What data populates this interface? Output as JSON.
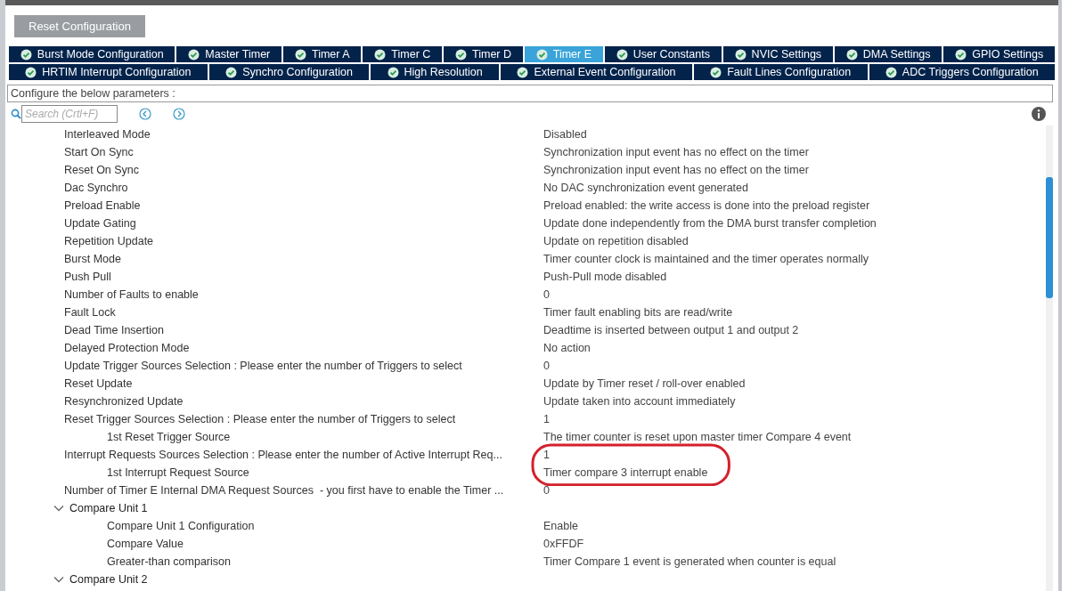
{
  "reset_button": "Reset Configuration",
  "tab_rows": [
    [
      {
        "label": "Burst Mode Configuration",
        "selected": false
      },
      {
        "label": "Master Timer",
        "selected": false
      },
      {
        "label": "Timer A",
        "selected": false
      },
      {
        "label": "Timer C",
        "selected": false
      },
      {
        "label": "Timer D",
        "selected": false
      },
      {
        "label": "Timer E",
        "selected": true
      },
      {
        "label": "User Constants",
        "selected": false
      },
      {
        "label": "NVIC Settings",
        "selected": false
      },
      {
        "label": "DMA Settings",
        "selected": false
      },
      {
        "label": "GPIO Settings",
        "selected": false
      }
    ],
    [
      {
        "label": "HRTIM Interrupt Configuration",
        "selected": false
      },
      {
        "label": "Synchro Configuration",
        "selected": false
      },
      {
        "label": "High Resolution",
        "selected": false
      },
      {
        "label": "External Event Configuration",
        "selected": false
      },
      {
        "label": "Fault Lines Configuration",
        "selected": false
      },
      {
        "label": "ADC Triggers Configuration",
        "selected": false
      }
    ]
  ],
  "description": "Configure the below parameters :",
  "search": {
    "placeholder": "Search (Crtl+F)"
  },
  "parameters": [
    {
      "kind": "param",
      "label": "Interleaved Mode",
      "value": "Disabled"
    },
    {
      "kind": "param",
      "label": "Start On Sync",
      "value": "Synchronization input event has no effect on the timer"
    },
    {
      "kind": "param",
      "label": "Reset On Sync",
      "value": "Synchronization input event has no effect on the timer"
    },
    {
      "kind": "param",
      "label": "Dac Synchro",
      "value": "No DAC synchronization event generated"
    },
    {
      "kind": "param",
      "label": "Preload Enable",
      "value": "Preload enabled: the write access is done into the preload register"
    },
    {
      "kind": "param",
      "label": "Update Gating",
      "value": "Update done independently from the DMA burst transfer completion"
    },
    {
      "kind": "param",
      "label": "Repetition Update",
      "value": "Update on repetition disabled"
    },
    {
      "kind": "param",
      "label": "Burst Mode",
      "value": "Timer counter clock is maintained and the timer operates normally"
    },
    {
      "kind": "param",
      "label": "Push Pull",
      "value": "Push-Pull mode disabled"
    },
    {
      "kind": "param",
      "label": "Number of Faults to enable",
      "value": "0"
    },
    {
      "kind": "param",
      "label": "Fault Lock",
      "value": "Timer fault enabling bits are read/write"
    },
    {
      "kind": "param",
      "label": "Dead Time Insertion",
      "value": "Deadtime is inserted between output 1 and output 2"
    },
    {
      "kind": "param",
      "label": "Delayed Protection Mode",
      "value": "No action"
    },
    {
      "kind": "param",
      "label": "Update Trigger Sources Selection : Please enter the number of Triggers to select",
      "value": "0"
    },
    {
      "kind": "param",
      "label": "Reset Update",
      "value": "Update by Timer reset / roll-over enabled"
    },
    {
      "kind": "param",
      "label": "Resynchronized Update",
      "value": "Update taken into account immediately"
    },
    {
      "kind": "param",
      "label": "Reset Trigger Sources Selection : Please enter the number of Triggers to select",
      "value": "1",
      "children": [
        {
          "kind": "param",
          "label": "1st Reset Trigger Source",
          "value": "The timer counter is reset upon master timer Compare 4 event"
        }
      ]
    },
    {
      "kind": "param",
      "label": "Interrupt Requests Sources Selection : Please enter the number of Active Interrupt Req...",
      "value": "1",
      "highlighted": true,
      "children": [
        {
          "kind": "param",
          "label": "1st Interrupt Request Source",
          "value": "Timer compare 3 interrupt enable",
          "highlighted": true
        }
      ]
    },
    {
      "kind": "param",
      "label": "Number of Timer E Internal DMA Request Sources  - you first have to enable the Timer ...",
      "value": "0"
    },
    {
      "kind": "group",
      "label": "Compare Unit 1",
      "expanded": true,
      "children": [
        {
          "kind": "param",
          "label": "Compare Unit 1 Configuration",
          "value": "Enable"
        },
        {
          "kind": "param",
          "label": "Compare Value",
          "value": "0xFFDF"
        },
        {
          "kind": "param",
          "label": "Greater-than comparison",
          "value": "Timer Compare 1 event is generated when counter is equal"
        }
      ]
    },
    {
      "kind": "group",
      "label": "Compare Unit 2",
      "expanded": true
    }
  ]
}
